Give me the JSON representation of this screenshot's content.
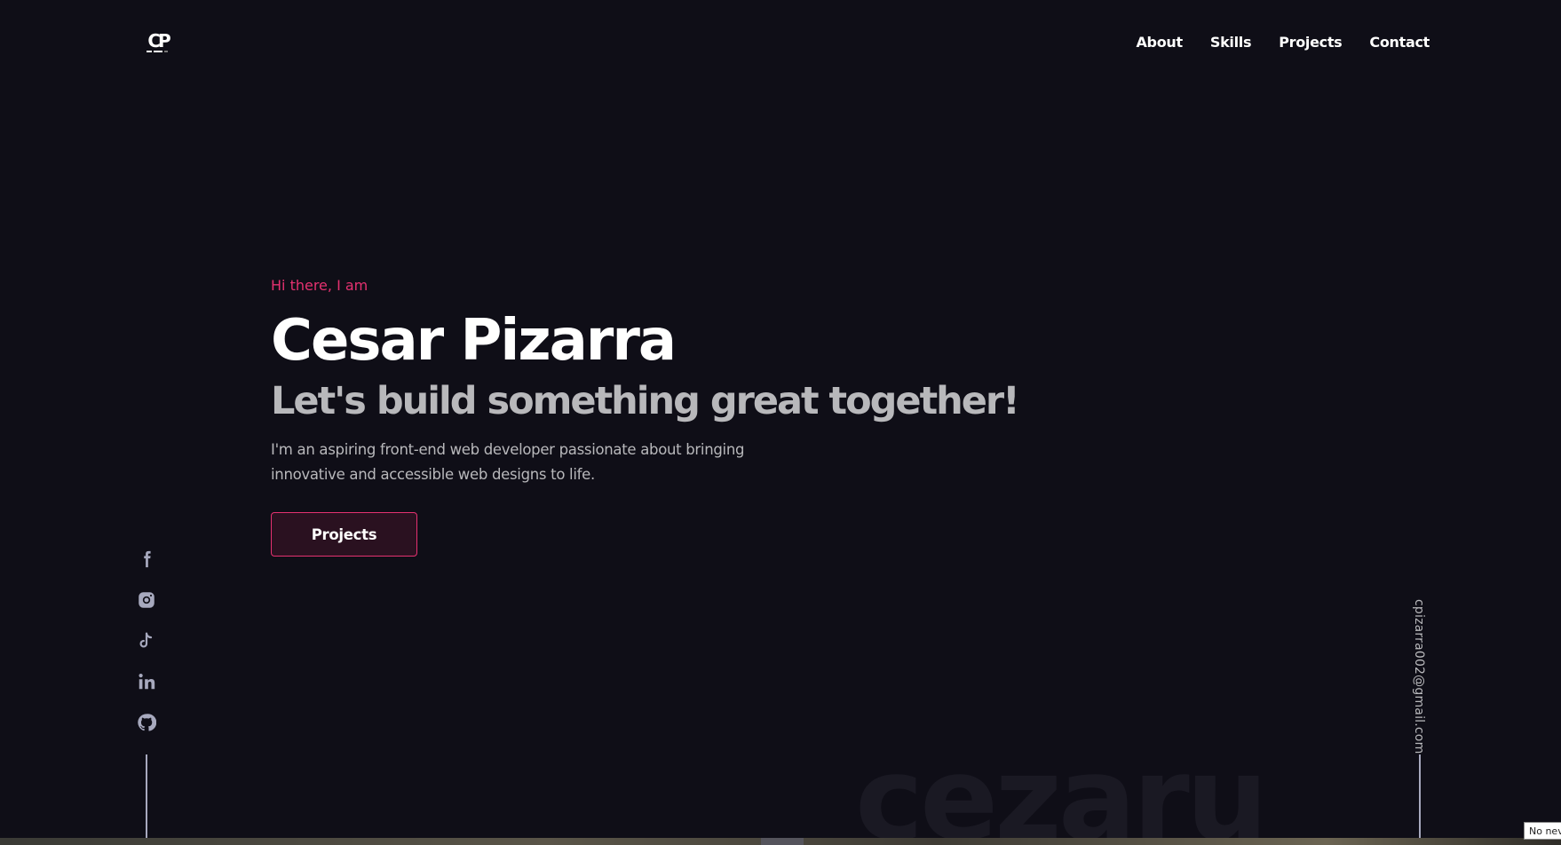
{
  "header": {
    "logo_text": "CP",
    "nav": [
      {
        "label": "About"
      },
      {
        "label": "Skills"
      },
      {
        "label": "Projects"
      },
      {
        "label": "Contact"
      }
    ]
  },
  "hero": {
    "greeting": "Hi there, I am",
    "name": "Cesar Pizarra",
    "tagline": "Let's build something great together!",
    "intro": "I'm an aspiring front-end web developer passionate about bringing innovative and accessible web designs to life.",
    "cta_label": "Projects"
  },
  "social": [
    {
      "icon": "facebook-icon"
    },
    {
      "icon": "instagram-icon"
    },
    {
      "icon": "tiktok-icon"
    },
    {
      "icon": "linkedin-icon"
    },
    {
      "icon": "github-icon"
    }
  ],
  "email": "cpizarra002@gmail.com",
  "background_word": "cezaru",
  "toast": "No nev",
  "colors": {
    "background": "#0f0e17",
    "accent": "#e53170",
    "text": "#fffffe",
    "muted": "#b8b8bb"
  }
}
